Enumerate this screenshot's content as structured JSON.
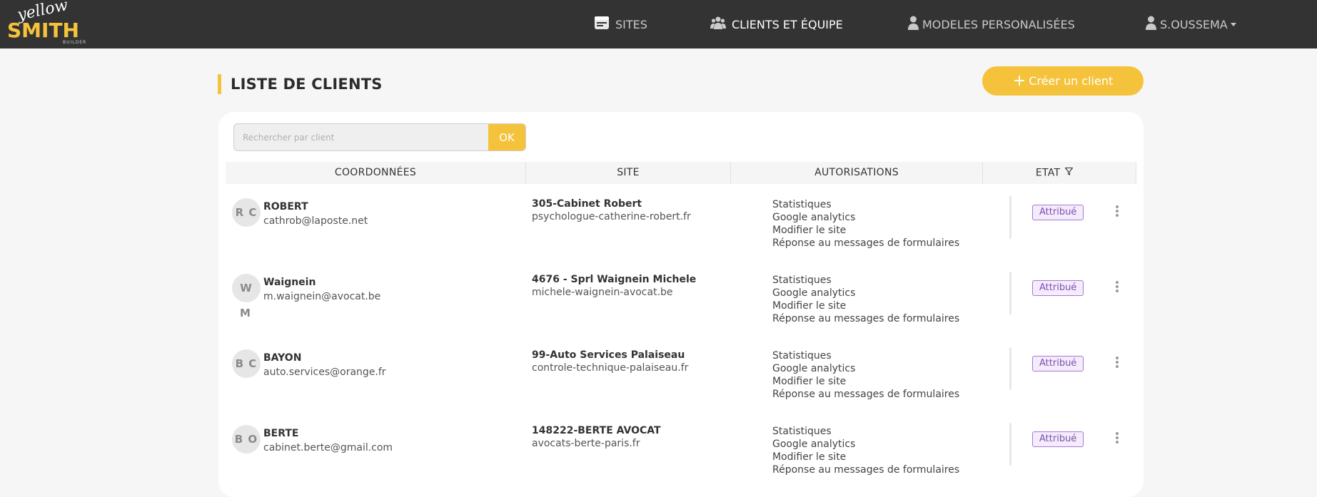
{
  "brand": {
    "line1": "yellow",
    "line2": "SMITH",
    "line3": "BUILDER"
  },
  "nav": {
    "sites": "SITES",
    "clients": "CLIENTS ET ÉQUIPE",
    "models": "MODELES PERSONALISÉES",
    "user": "S.OUSSEMA"
  },
  "page": {
    "title": "LISTE DE CLIENTS",
    "create_label": "Créer un client"
  },
  "search": {
    "placeholder": "Rechercher par client",
    "button": "OK"
  },
  "table": {
    "headers": {
      "coords": "COORDONNÉES",
      "site": "SITE",
      "auth": "AUTORISATIONS",
      "etat": "ETAT"
    },
    "rows": [
      {
        "initials": "R C",
        "initials_extra": "",
        "name": "ROBERT",
        "email": "cathrob@laposte.net",
        "site_name": "305-Cabinet Robert",
        "site_url": "psychologue-catherine-robert.fr",
        "perms": [
          "Statistiques",
          "Google analytics",
          "Modifier le site",
          "Réponse au messages de formulaires"
        ],
        "status": "Attribué"
      },
      {
        "initials": "W",
        "initials_extra": "M",
        "name": "Waignein",
        "email": "m.waignein@avocat.be",
        "site_name": "4676 - Sprl Waignein Michele",
        "site_url": "michele-waignein-avocat.be",
        "perms": [
          "Statistiques",
          "Google analytics",
          "Modifier le site",
          "Réponse au messages de formulaires"
        ],
        "status": "Attribué"
      },
      {
        "initials": "B C",
        "initials_extra": "",
        "name": "BAYON",
        "email": "auto.services@orange.fr",
        "site_name": "99-Auto Services Palaiseau",
        "site_url": "controle-technique-palaiseau.fr",
        "perms": [
          "Statistiques",
          "Google analytics",
          "Modifier le site",
          "Réponse au messages de formulaires"
        ],
        "status": "Attribué"
      },
      {
        "initials": "B O",
        "initials_extra": "",
        "name": "BERTE",
        "email": "cabinet.berte@gmail.com",
        "site_name": "148222-BERTE AVOCAT",
        "site_url": "avocats-berte-paris.fr",
        "perms": [
          "Statistiques",
          "Google analytics",
          "Modifier le site",
          "Réponse au messages de formulaires"
        ],
        "status": "Attribué"
      }
    ]
  },
  "colors": {
    "topbar": "#333333",
    "accent": "#f5c33b",
    "badge": "#7e4fb3"
  },
  "icons": {
    "sites": "browser-window-icon",
    "clients": "users-group-icon",
    "models": "user-icon",
    "user": "user-icon",
    "filter": "filter-icon",
    "more": "kebab-menu-icon"
  }
}
